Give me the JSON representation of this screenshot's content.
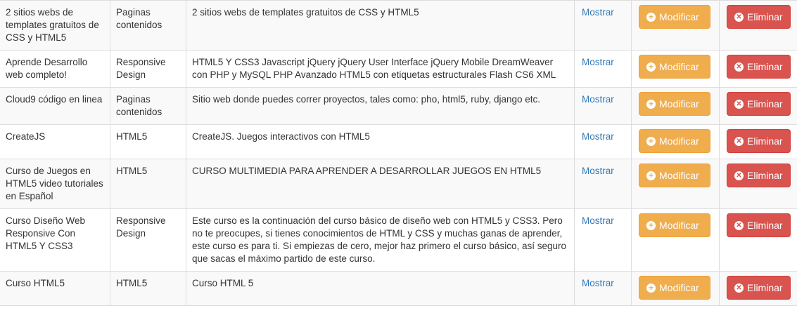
{
  "table": {
    "rows": [
      {
        "name": "2 sitios webs de templates gratuitos de CSS y HTML5",
        "category": "Paginas contenidos",
        "description": "2 sitios webs de templates gratuitos de CSS y HTML5"
      },
      {
        "name": "Aprende Desarrollo web completo!",
        "category": "Responsive Design",
        "description": "HTML5 Y CSS3 Javascript jQuery jQuery User Interface jQuery Mobile DreamWeaver con PHP y MySQL PHP Avanzado HTML5 con etiquetas estructurales Flash CS6 XML"
      },
      {
        "name": "Cloud9 código en linea",
        "category": "Paginas contenidos",
        "description": "Sitio web donde puedes correr proyectos, tales como: pho, html5, ruby, django etc."
      },
      {
        "name": "CreateJS",
        "category": "HTML5",
        "description": "CreateJS. Juegos interactivos con HTML5"
      },
      {
        "name": "Curso de Juegos en HTML5 video tutoriales en Español",
        "category": "HTML5",
        "description": "CURSO MULTIMEDIA PARA APRENDER A DESARROLLAR JUEGOS EN HTML5"
      },
      {
        "name": "Curso Diseño Web Responsive Con HTML5 Y CSS3",
        "category": "Responsive Design",
        "description": "Este curso es la continuación del curso básico de diseño web con HTML5 y CSS3. Pero no te preocupes, si tienes conocimientos de HTML y CSS y muchas ganas de aprender, este curso es para ti. Si empiezas de cero, mejor haz primero el curso básico, así seguro que sacas el máximo partido de este curso."
      },
      {
        "name": "Curso HTML5",
        "category": "HTML5",
        "description": "Curso HTML 5"
      }
    ]
  },
  "actions": {
    "show_label": "Mostrar",
    "edit_label": "Modificar",
    "delete_label": "Eliminar",
    "edit_icon": "plus-circle-icon",
    "delete_icon": "remove-circle-icon"
  },
  "colors": {
    "link": "#337ab7",
    "warning": "#f0ad4e",
    "danger": "#d9534f",
    "border": "#dddddd",
    "stripe": "#f9f9f9"
  }
}
